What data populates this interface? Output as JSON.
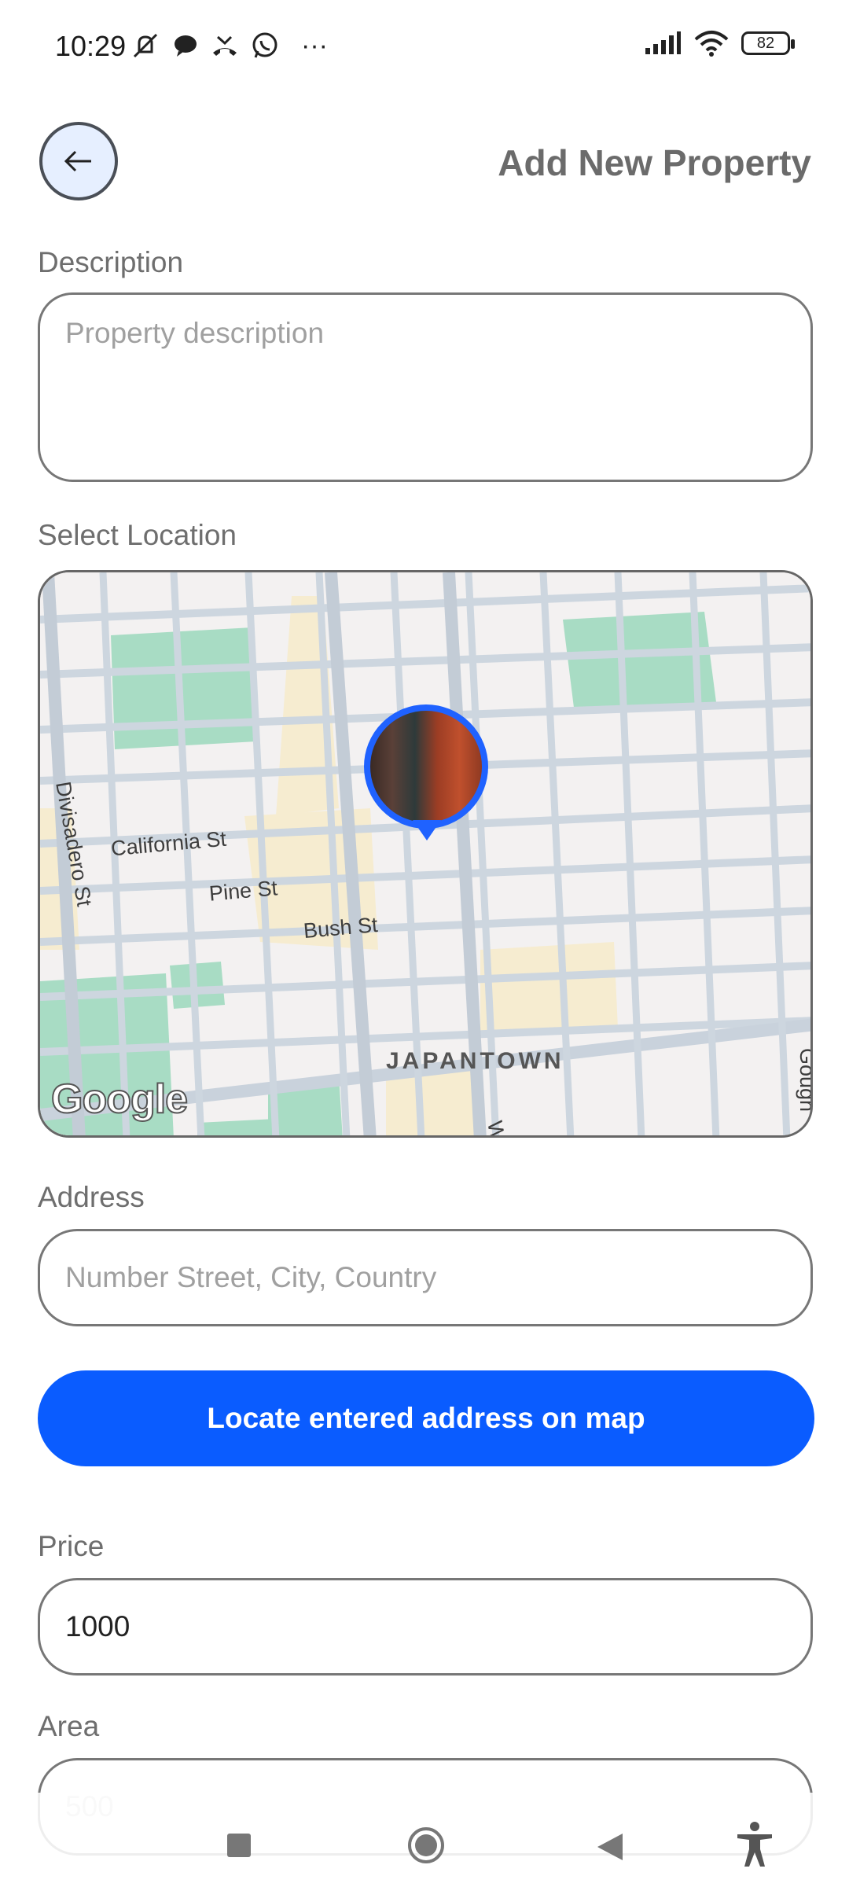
{
  "status_bar": {
    "time": "10:29",
    "battery": "82",
    "more": "···"
  },
  "header": {
    "title": "Add New Property",
    "back_icon": "arrow-left-icon"
  },
  "description": {
    "label": "Description",
    "placeholder": "Property description"
  },
  "location": {
    "label": "Select Location",
    "map": {
      "streets": [
        "California St",
        "Pine St",
        "Bush St",
        "Divisadero St",
        "Gough"
      ],
      "neighborhood": "JAPANTOWN",
      "partial_street": "W",
      "attribution": "Google"
    }
  },
  "address": {
    "label": "Address",
    "placeholder": "Number Street, City, Country"
  },
  "locate_button": "Locate entered address on map",
  "price": {
    "label": "Price",
    "value": "1000"
  },
  "area": {
    "label": "Area",
    "value": "500"
  },
  "colors": {
    "accent": "#0a5cff",
    "pin": "#1f62ff",
    "park": "#a8dcc4",
    "commercial": "#f6ecd0"
  }
}
